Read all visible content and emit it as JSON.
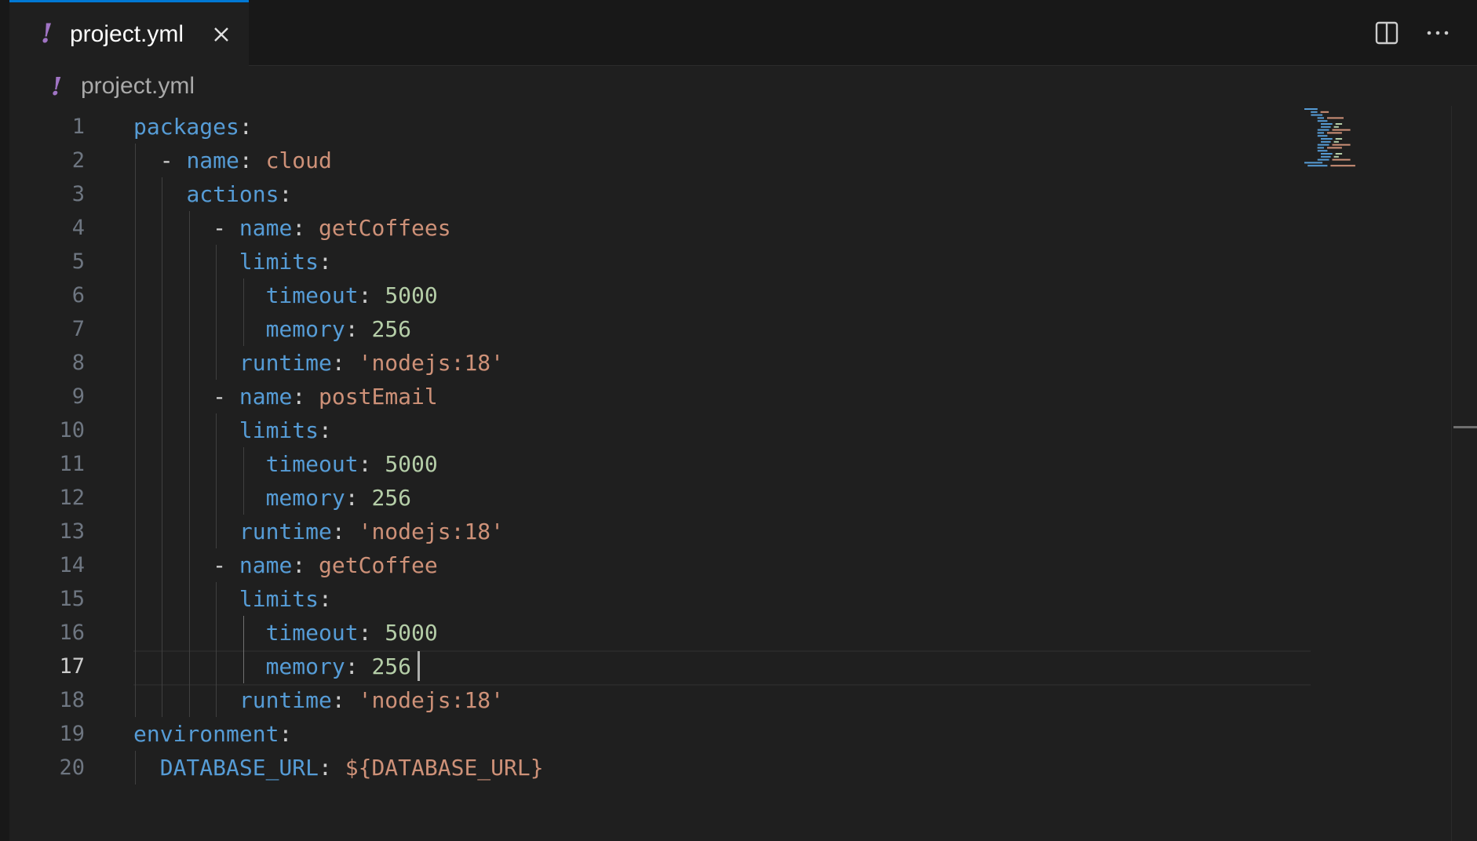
{
  "tab": {
    "label": "project.yml",
    "icon": "yaml-icon"
  },
  "breadcrumb": {
    "label": "project.yml",
    "icon": "yaml-icon"
  },
  "colors": {
    "key": "#569cd6",
    "string": "#ce9178",
    "number": "#b5cea8",
    "accent": "#0078d4",
    "yaml_icon": "#a074c4"
  },
  "editor": {
    "active_line": 17,
    "lines": [
      {
        "num": "1",
        "indent": "",
        "dash": "",
        "key": "packages",
        "colon": ":",
        "value": "",
        "value_type": ""
      },
      {
        "num": "2",
        "indent": "  ",
        "dash": "- ",
        "key": "name",
        "colon": ": ",
        "value": "cloud",
        "value_type": "s"
      },
      {
        "num": "3",
        "indent": "    ",
        "dash": "",
        "key": "actions",
        "colon": ":",
        "value": "",
        "value_type": ""
      },
      {
        "num": "4",
        "indent": "      ",
        "dash": "- ",
        "key": "name",
        "colon": ": ",
        "value": "getCoffees",
        "value_type": "s"
      },
      {
        "num": "5",
        "indent": "        ",
        "dash": "",
        "key": "limits",
        "colon": ":",
        "value": "",
        "value_type": ""
      },
      {
        "num": "6",
        "indent": "          ",
        "dash": "",
        "key": "timeout",
        "colon": ": ",
        "value": "5000",
        "value_type": "n"
      },
      {
        "num": "7",
        "indent": "          ",
        "dash": "",
        "key": "memory",
        "colon": ": ",
        "value": "256",
        "value_type": "n"
      },
      {
        "num": "8",
        "indent": "        ",
        "dash": "",
        "key": "runtime",
        "colon": ": ",
        "value": "'nodejs:18'",
        "value_type": "s"
      },
      {
        "num": "9",
        "indent": "      ",
        "dash": "- ",
        "key": "name",
        "colon": ": ",
        "value": "postEmail",
        "value_type": "s"
      },
      {
        "num": "10",
        "indent": "        ",
        "dash": "",
        "key": "limits",
        "colon": ":",
        "value": "",
        "value_type": ""
      },
      {
        "num": "11",
        "indent": "          ",
        "dash": "",
        "key": "timeout",
        "colon": ": ",
        "value": "5000",
        "value_type": "n"
      },
      {
        "num": "12",
        "indent": "          ",
        "dash": "",
        "key": "memory",
        "colon": ": ",
        "value": "256",
        "value_type": "n"
      },
      {
        "num": "13",
        "indent": "        ",
        "dash": "",
        "key": "runtime",
        "colon": ": ",
        "value": "'nodejs:18'",
        "value_type": "s"
      },
      {
        "num": "14",
        "indent": "      ",
        "dash": "- ",
        "key": "name",
        "colon": ": ",
        "value": "getCoffee",
        "value_type": "s"
      },
      {
        "num": "15",
        "indent": "        ",
        "dash": "",
        "key": "limits",
        "colon": ":",
        "value": "",
        "value_type": ""
      },
      {
        "num": "16",
        "indent": "          ",
        "dash": "",
        "key": "timeout",
        "colon": ": ",
        "value": "5000",
        "value_type": "n"
      },
      {
        "num": "17",
        "indent": "          ",
        "dash": "",
        "key": "memory",
        "colon": ": ",
        "value": "256",
        "value_type": "n"
      },
      {
        "num": "18",
        "indent": "        ",
        "dash": "",
        "key": "runtime",
        "colon": ": ",
        "value": "'nodejs:18'",
        "value_type": "s"
      },
      {
        "num": "19",
        "indent": "",
        "dash": "",
        "key": "environment",
        "colon": ":",
        "value": "",
        "value_type": ""
      },
      {
        "num": "20",
        "indent": "  ",
        "dash": "",
        "key": "DATABASE_URL",
        "colon": ": ",
        "value": "${DATABASE_URL}",
        "value_type": "s"
      }
    ]
  }
}
